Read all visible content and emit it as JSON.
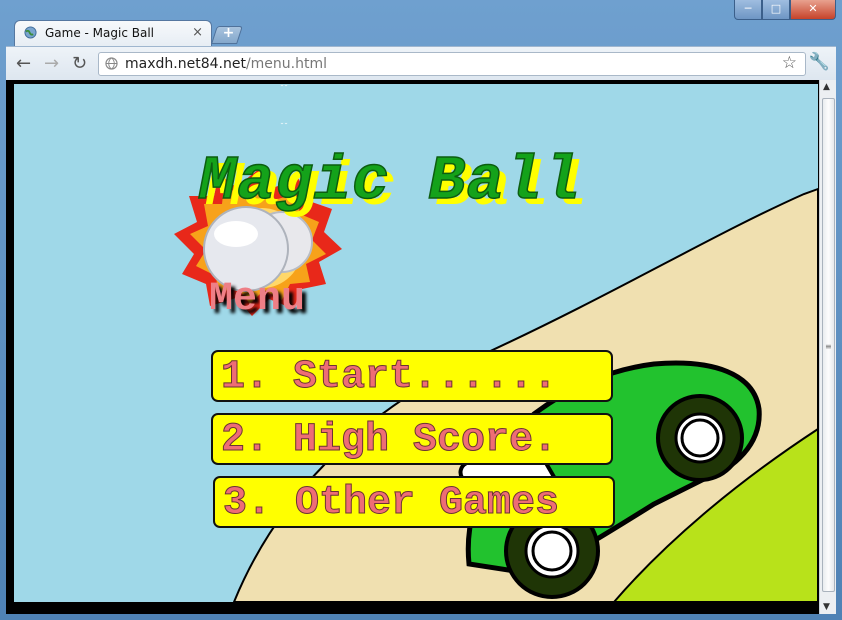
{
  "browser": {
    "tab_title": "Game - Magic Ball",
    "tab_close": "×",
    "new_tab": "+",
    "url_host": "maxdh.net84.net",
    "url_path": "/menu.html",
    "window_buttons": {
      "minimize": "─",
      "maximize": "□",
      "close": "✕"
    },
    "nav": {
      "back": "←",
      "forward": "→",
      "reload": "↻"
    }
  },
  "game": {
    "title": "Magic Ball",
    "menu_title": "Menu",
    "menu_items": [
      {
        "label": "1. Start......"
      },
      {
        "label": "2. High Score."
      },
      {
        "label": "3. Other Games"
      }
    ]
  },
  "colors": {
    "sky": "#9fd8e8",
    "sand": "#f0e0b0",
    "grass": "#b8e21a",
    "title_green": "#14a21a",
    "title_shadow": "#ffff00",
    "button_yellow": "#ffff00",
    "menu_text": "#ee6d75",
    "car_green": "#22c22e"
  },
  "icons": [
    "globe-icon",
    "close-icon",
    "back-icon",
    "forward-icon",
    "reload-icon",
    "page-icon",
    "star-icon",
    "wrench-icon",
    "ball-explosion-icon",
    "car-icon"
  ]
}
